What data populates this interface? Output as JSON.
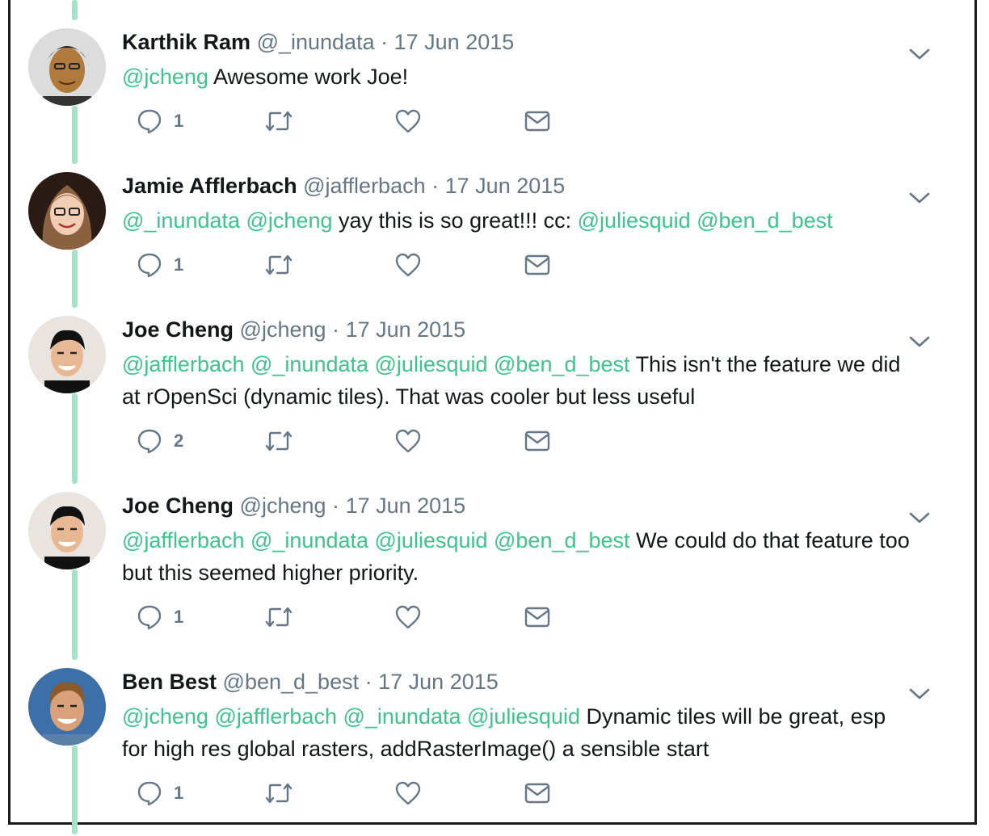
{
  "tweets": [
    {
      "name": "Karthik Ram",
      "handle": "@_inundata",
      "sep": "·",
      "date": "17 Jun 2015",
      "mentions": "@jcheng",
      "text": "Awesome work Joe!",
      "text2": "",
      "reply_count": "1",
      "avatar": "avatar-karthik"
    },
    {
      "name": "Jamie Afflerbach",
      "handle": "@jafflerbach",
      "sep": "·",
      "date": "17 Jun 2015",
      "mentions": "@_inundata @jcheng",
      "text": "yay this is so great!!! cc:",
      "mentions2": "@juliesquid @ben_d_best",
      "reply_count": "1",
      "avatar": "avatar-jamie"
    },
    {
      "name": "Joe Cheng",
      "handle": "@jcheng",
      "sep": "·",
      "date": "17 Jun 2015",
      "mentions": "@jafflerbach @_inundata @juliesquid @ben_d_best",
      "text": "This isn't the feature we did",
      "text2": "at rOpenSci (dynamic tiles). That was cooler but less useful",
      "reply_count": "2",
      "avatar": "avatar-joe"
    },
    {
      "name": "Joe Cheng",
      "handle": "@jcheng",
      "sep": "·",
      "date": "17 Jun 2015",
      "mentions": "@jafflerbach @_inundata @juliesquid @ben_d_best",
      "text": "We could do that feature too",
      "text2": "but this seemed higher priority.",
      "reply_count": "1",
      "avatar": "avatar-joe"
    },
    {
      "name": "Ben Best",
      "handle": "@ben_d_best",
      "sep": "·",
      "date": "17 Jun 2015",
      "mentions": "@jcheng @jafflerbach @_inundata @juliesquid",
      "text": " Dynamic tiles will be great, esp",
      "text2": "for high res global rasters, addRasterImage() a sensible start",
      "reply_count": "1",
      "avatar": "avatar-ben"
    }
  ],
  "icons": {
    "reply": "reply-icon",
    "retweet": "retweet-icon",
    "like": "heart-icon",
    "dm": "mail-icon",
    "more": "chevron-down-icon"
  },
  "colors": {
    "mention": "#3cc48c",
    "thread": "#a3e3c6",
    "secondary": "#657786"
  }
}
